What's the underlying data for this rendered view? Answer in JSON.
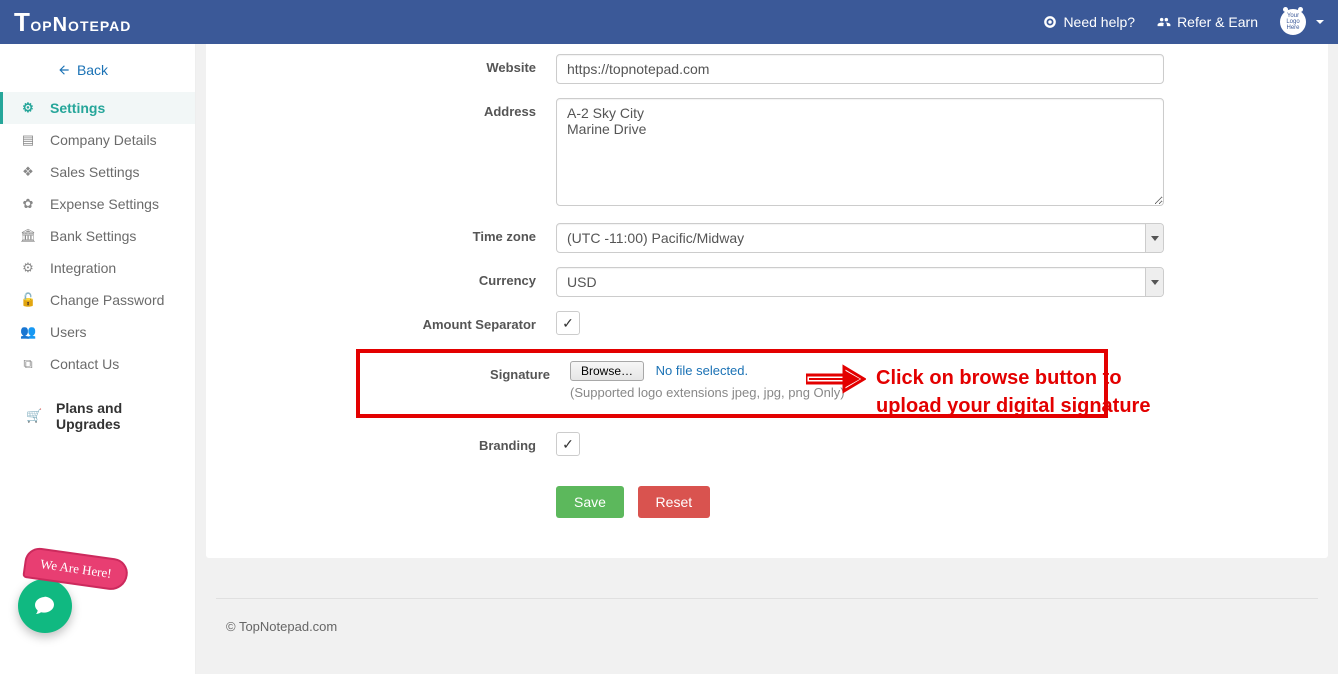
{
  "header": {
    "brand_big": "T",
    "brand_rest": "opNotepad",
    "need_help": "Need help?",
    "refer_earn": "Refer & Earn",
    "logo_text": "Your Logo Here"
  },
  "sidebar": {
    "back": "Back",
    "items": [
      {
        "label": "Settings",
        "icon": "gear",
        "active": true
      },
      {
        "label": "Company Details",
        "icon": "file"
      },
      {
        "label": "Sales Settings",
        "icon": "layers"
      },
      {
        "label": "Expense Settings",
        "icon": "gear"
      },
      {
        "label": "Bank Settings",
        "icon": "bank"
      },
      {
        "label": "Integration",
        "icon": "gears"
      },
      {
        "label": "Change Password",
        "icon": "lock"
      },
      {
        "label": "Users",
        "icon": "users"
      },
      {
        "label": "Contact Us",
        "icon": "idcard"
      }
    ],
    "plans": "Plans and Upgrades"
  },
  "form": {
    "website_label": "Website",
    "website_value": "https://topnotepad.com",
    "address_label": "Address",
    "address_value": "A-2 Sky City\nMarine Drive",
    "timezone_label": "Time zone",
    "timezone_value": "(UTC -11:00) Pacific/Midway",
    "currency_label": "Currency",
    "currency_value": "USD",
    "amount_sep_label": "Amount Separator",
    "amount_sep_checked": true,
    "signature_label": "Signature",
    "browse_btn": "Browse…",
    "no_file": "No file selected.",
    "signature_hint": "(Supported logo extensions jpeg, jpg, png Only)",
    "branding_label": "Branding",
    "branding_checked": true,
    "save_btn": "Save",
    "reset_btn": "Reset"
  },
  "annotation": {
    "line1": "Click on browse button to",
    "line2": "upload your digital signature"
  },
  "footer": {
    "copyright": "© TopNotepad.com"
  },
  "chat": {
    "ribbon": "We Are Here!"
  }
}
